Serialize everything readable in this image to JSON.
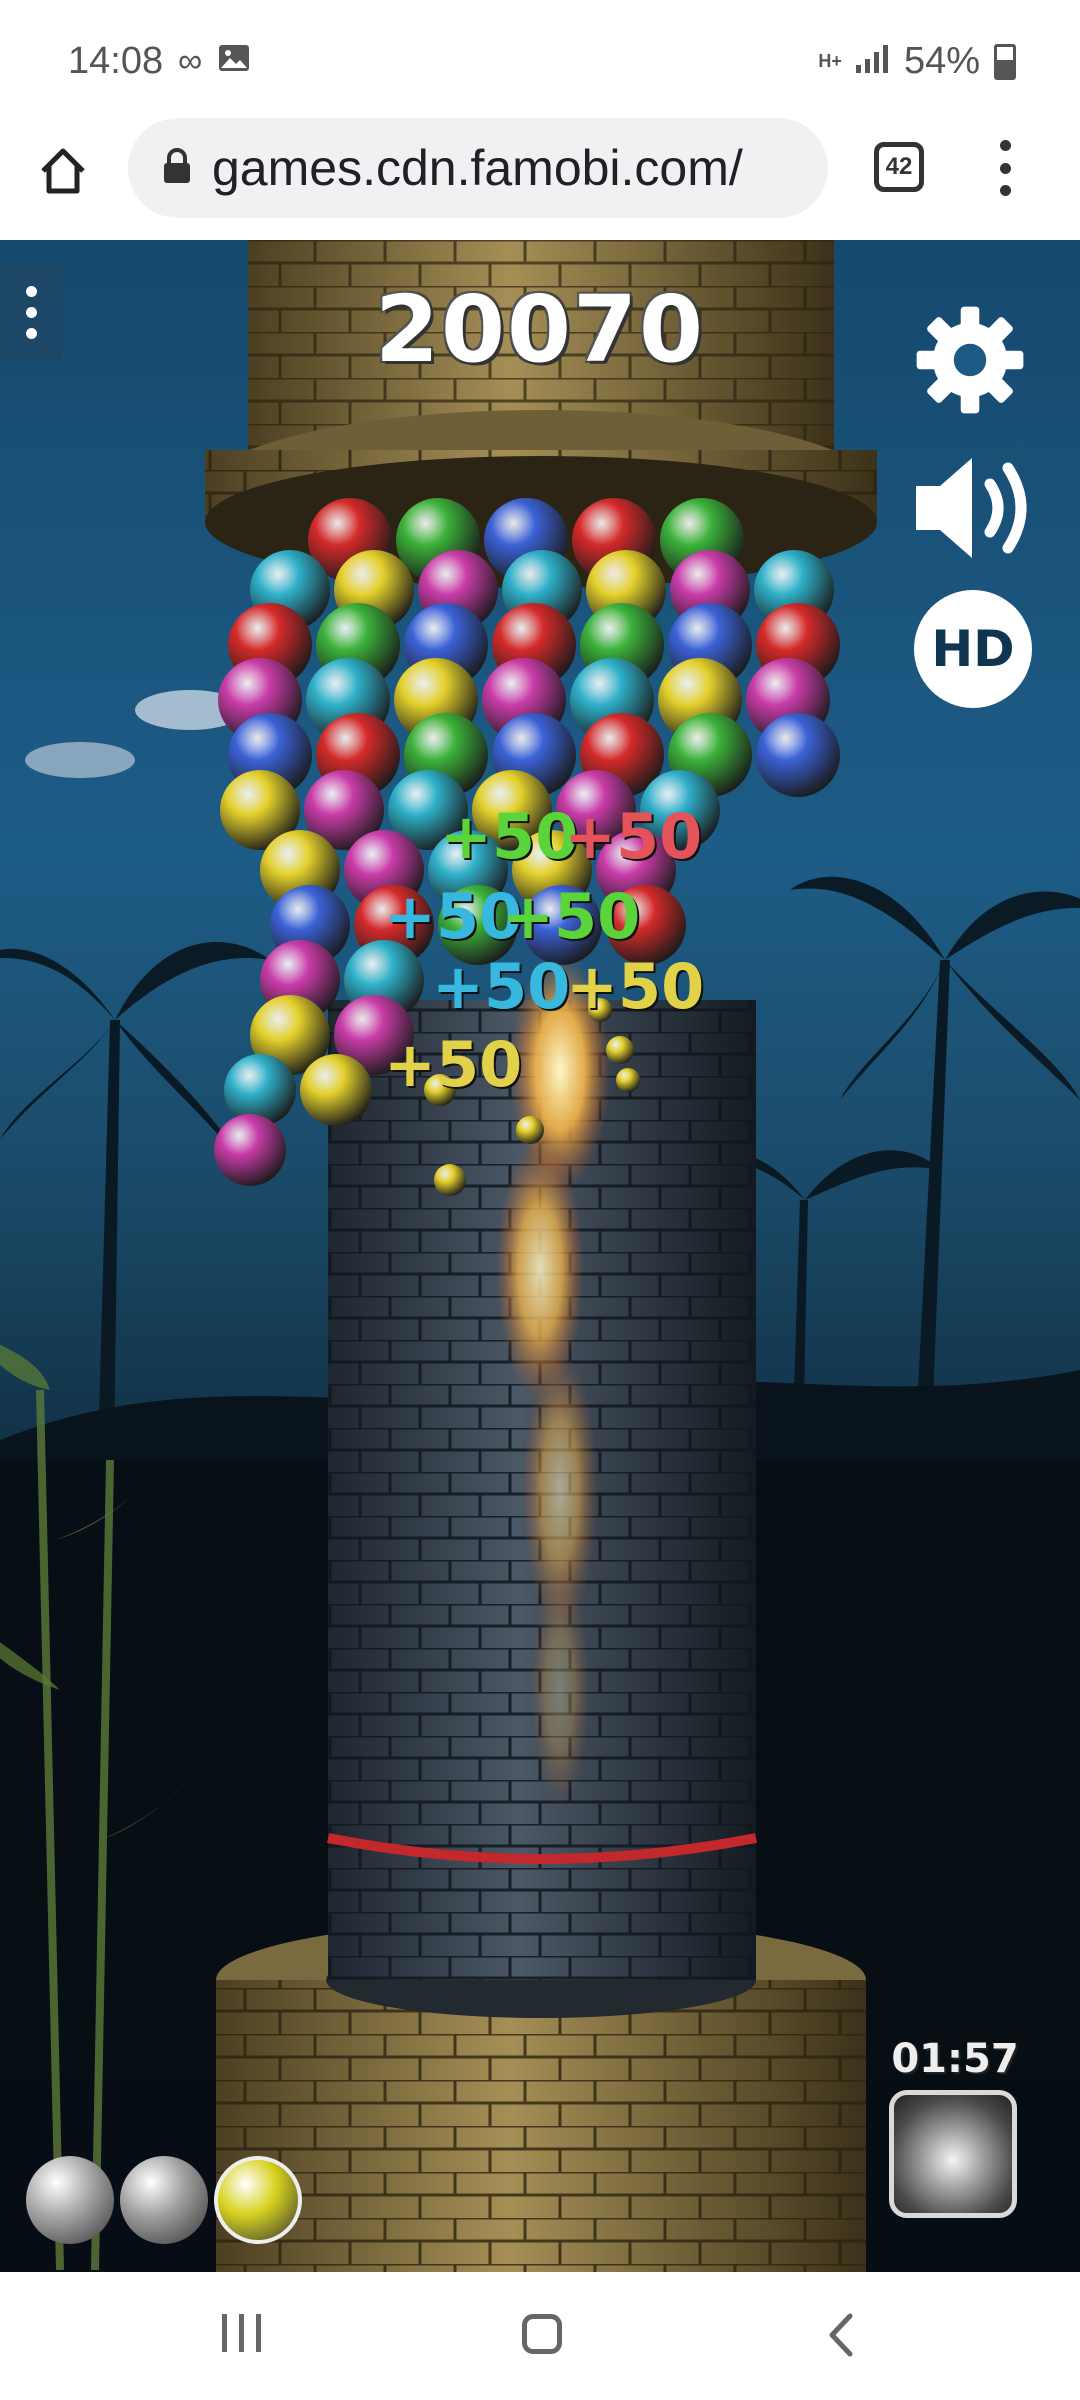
{
  "status_bar": {
    "time": "14:08",
    "left_icons": [
      "infinity-icon",
      "image-icon"
    ],
    "network": "H+",
    "battery": "54%"
  },
  "browser": {
    "url": "games.cdn.famobi.com/",
    "tab_count": "42"
  },
  "game": {
    "score": "20070",
    "hd_label": "HD",
    "timer": "01:57",
    "points_popups": [
      "+50",
      "+50",
      "+50",
      "+50",
      "+50",
      "+50",
      "+50"
    ],
    "next_balls": [
      {
        "color": "#a8a8a8"
      },
      {
        "color": "#a0a0a0"
      },
      {
        "color": "#d7d21e"
      }
    ],
    "ball_colors": [
      "#d42a2a",
      "#c93ca8",
      "#3b62d6",
      "#e3d02c",
      "#3cb23a",
      "#2fb0c9"
    ]
  }
}
